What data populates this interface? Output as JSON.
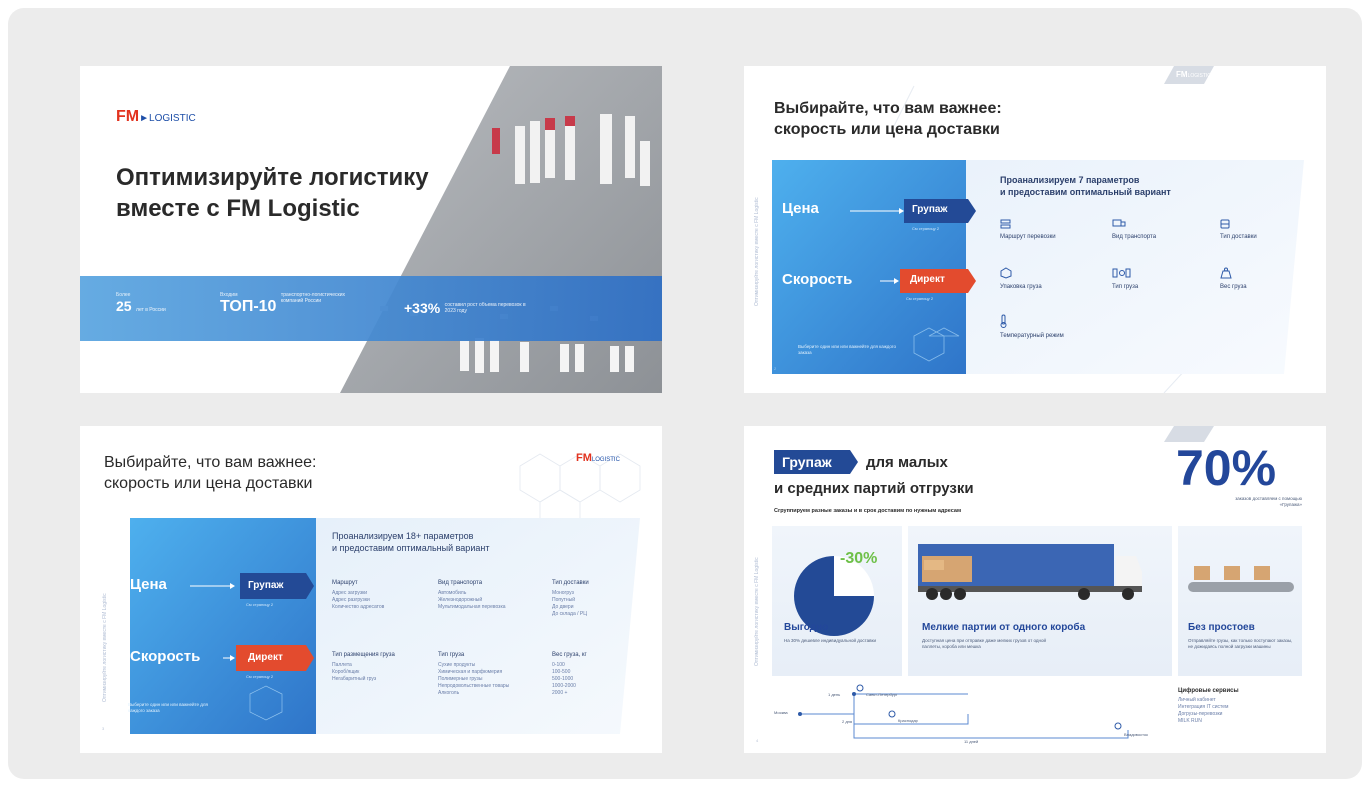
{
  "colors": {
    "brand_red": "#e2331f",
    "brand_blue": "#1e4fa8",
    "light_blue": "#4aa8e8",
    "dark_blue": "#1f3f8a"
  },
  "slide1": {
    "logo_fm": "FM",
    "logo_text": "LOGISTIC",
    "headline_line1": "Оптимизируйте логистику",
    "headline_line2": "вместе с FM Logistic",
    "stat1_small": "Более",
    "stat1_num": "25",
    "stat1_desc": "лет в России",
    "stat2_small": "Входим",
    "stat2_num": "ТОП-10",
    "stat2_desc": "транспортно-логистических компаний России",
    "stat3_num": "+33%",
    "stat3_desc": "составил рост объема перевозок в 2023 году"
  },
  "slide2": {
    "logo_fm": "FM",
    "logo_text": "LOGISTIC",
    "title_line1": "Выбирайте, что вам важнее:",
    "title_line2": "скорость или цена доставки",
    "price_label": "Цена",
    "speed_label": "Скорость",
    "pill_groupage": "Групаж",
    "pill_direct": "Директ",
    "pill_sub": "См страницу 2",
    "left_note": "Выберите один или или важнейте для каждого заказа",
    "panel_title_line1": "Проанализируем 7 параметров",
    "panel_title_line2": "и предоставим оптимальный вариант",
    "params": [
      "Маршрут перевозки",
      "Вид транспорта",
      "Тип доставки",
      "Упаковка груза",
      "Тип груза",
      "Вес груза",
      "Температурный режим"
    ],
    "side_text": "Оптимизируйте логистику вместе с FM Logistic",
    "page_no": "2"
  },
  "slide3": {
    "logo_fm": "FM",
    "logo_text": "LOGISTIC",
    "title_line1": "Выбирайте, что вам важнее:",
    "title_line2": "скорость или цена доставки",
    "price_label": "Цена",
    "speed_label": "Скорость",
    "pill_groupage": "Групаж",
    "pill_direct": "Директ",
    "pill_sub": "См страницу 2",
    "left_note": "Выберите один или или важнейте для каждого заказа",
    "panel_title_line1": "Проанализируем 18+ параметров",
    "panel_title_line2": "и предоставим оптимальный вариант",
    "groups": [
      {
        "title": "Маршрут",
        "items": [
          "Адрес загрузки",
          "Адрес разгрузки",
          "Количество адресатов"
        ]
      },
      {
        "title": "Вид транспорта",
        "items": [
          "Автомобиль",
          "Железнодорожный",
          "Мультимодальная перевозка"
        ]
      },
      {
        "title": "Тип доставки",
        "items": [
          "Моногруз",
          "Попутный",
          "До двери",
          "До склада / РЦ"
        ]
      },
      {
        "title": "Тип размещения груза",
        "items": [
          "Паллета",
          "Короб/ящик",
          "Негабаритный груз"
        ]
      },
      {
        "title": "Тип груза",
        "items": [
          "Сухие продукты",
          "Химическая и парфюмерия",
          "Полимерные грузы",
          "Непродовольственные товары",
          "Алкоголь"
        ]
      },
      {
        "title": "Вес груза, кг",
        "items": [
          "0-100",
          "100-500",
          "500-1000",
          "1000-2000",
          "2000 +"
        ]
      }
    ],
    "side_text": "Оптимизируйте логистику вместе с FM Logistic",
    "page_no": "3"
  },
  "slide4": {
    "logo_fm": "FM",
    "logo_text": "LOGISTIC",
    "badge": "Групаж",
    "title_line1": "для малых",
    "title_line2": "и средних партий отгрузки",
    "subtitle": "Сгруппируем разные заказы и в срок доставим по нужным адресам",
    "big_pct": "70%",
    "big_pct_desc": "заказов доставляем с помощью «Групажа»",
    "pie_label": "-30%",
    "card1_title": "Выгодно",
    "card1_text": "На 30% дешевле индивидуальной доставки",
    "card2_title": "Мелкие партии от одного короба",
    "card2_text": "Доступная цена при отправке даже мелких грузов от одной паллеты, короба или мешка",
    "card3_title": "Без простоев",
    "card3_text": "Отправляйте грузы, как только поступают заказы, не дожидаясь полной загрузки машины",
    "route_start": "Москва",
    "route_stops": [
      "Санкт-Петербург",
      "Краснодар",
      "Владивосток"
    ],
    "route_times": [
      "1 день",
      "2 дня",
      "11 дней"
    ],
    "services_title": "Цифровые сервисы",
    "services": [
      "Личный кабинет",
      "Интеграция IT систем",
      "Догрузы-перевозки",
      "MILK RUN"
    ],
    "side_text": "Оптимизируйте логистику вместе с FM Logistic",
    "page_no": "4"
  }
}
